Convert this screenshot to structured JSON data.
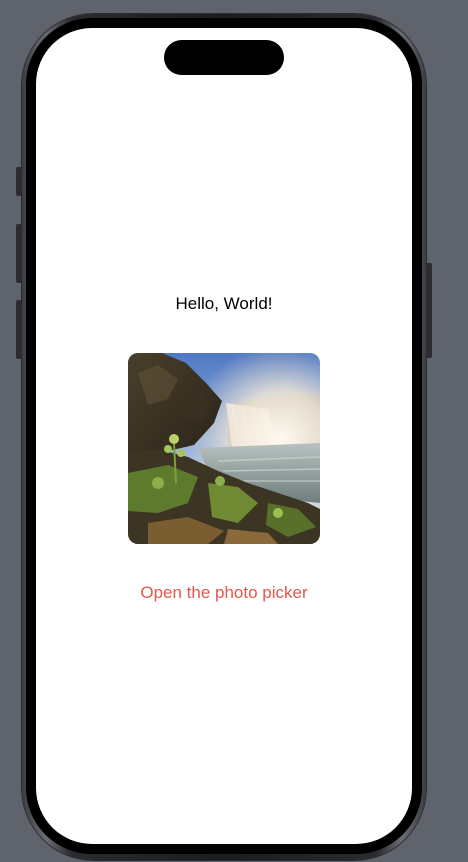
{
  "content": {
    "greeting": "Hello, World!",
    "photo_description": "waterfall-landscape-photo",
    "picker_button_label": "Open the photo picker"
  },
  "colors": {
    "background": "#5f636b",
    "screen": "#ffffff",
    "accent": "#e4574a",
    "text": "#000000"
  }
}
